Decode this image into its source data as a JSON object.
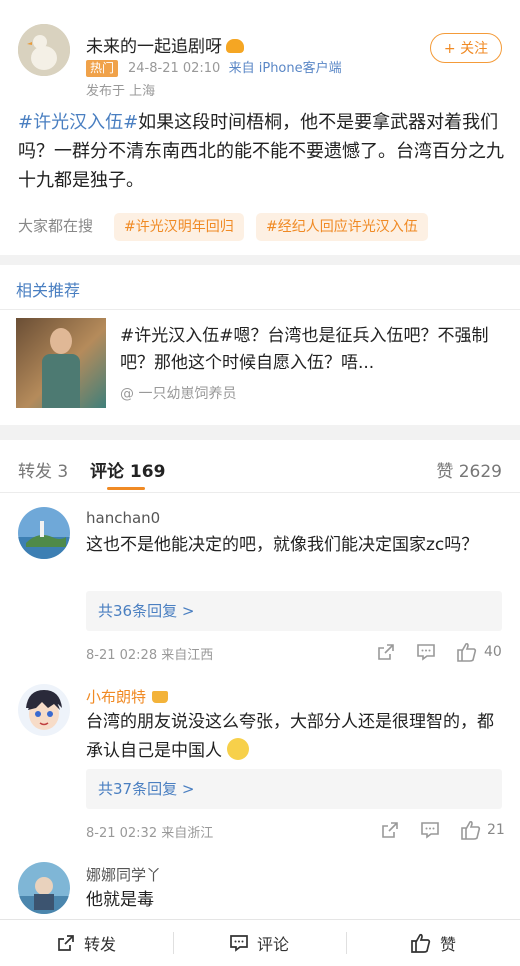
{
  "post": {
    "username": "未来的一起追剧呀",
    "hot_badge": "热门",
    "time": "24-8-21 02:10",
    "source": "来自 iPhone客户端",
    "location": "发布于 上海",
    "follow_label": "+ 关注",
    "hashtag": "#许光汉入伍#",
    "body": "如果这段时间梧桐，他不是要拿武器对着我们吗？一群分不清东南西北的能不能不要遗憾了。台湾百分之九十九都是独子。",
    "search_label": "大家都在搜",
    "search_tags": [
      "#许光汉明年回归",
      "#经纪人回应许光汉入伍"
    ]
  },
  "recommend": {
    "title": "相关推荐",
    "text": "#许光汉入伍#嗯？台湾也是征兵入伍吧？不强制吧？那他这个时候自愿入伍？唔...",
    "author": "@ 一只幼崽饲养员"
  },
  "tabs": {
    "repost": "转发 3",
    "comment": "评论 169",
    "like": "赞 2629"
  },
  "comments": [
    {
      "name": "hanchan0",
      "text": "这也不是他能决定的吧，就像我们能决定国家zc吗？",
      "replies": "共36条回复 >",
      "meta": "8-21 02:28  来自江西",
      "likes": "40"
    },
    {
      "name": "小布朗特",
      "text": "台湾的朋友说没这么夸张，大部分人还是很理智的，都承认自己是中国人",
      "replies": "共37条回复 >",
      "meta": "8-21 02:32  来自浙江",
      "likes": "21"
    },
    {
      "name": "娜娜同学丫",
      "text": "他就是毒"
    }
  ],
  "bottom_bar": {
    "repost": "转发",
    "comment": "评论",
    "like": "赞"
  },
  "colors": {
    "accent": "#f08a24",
    "link": "#4a7fc1"
  }
}
